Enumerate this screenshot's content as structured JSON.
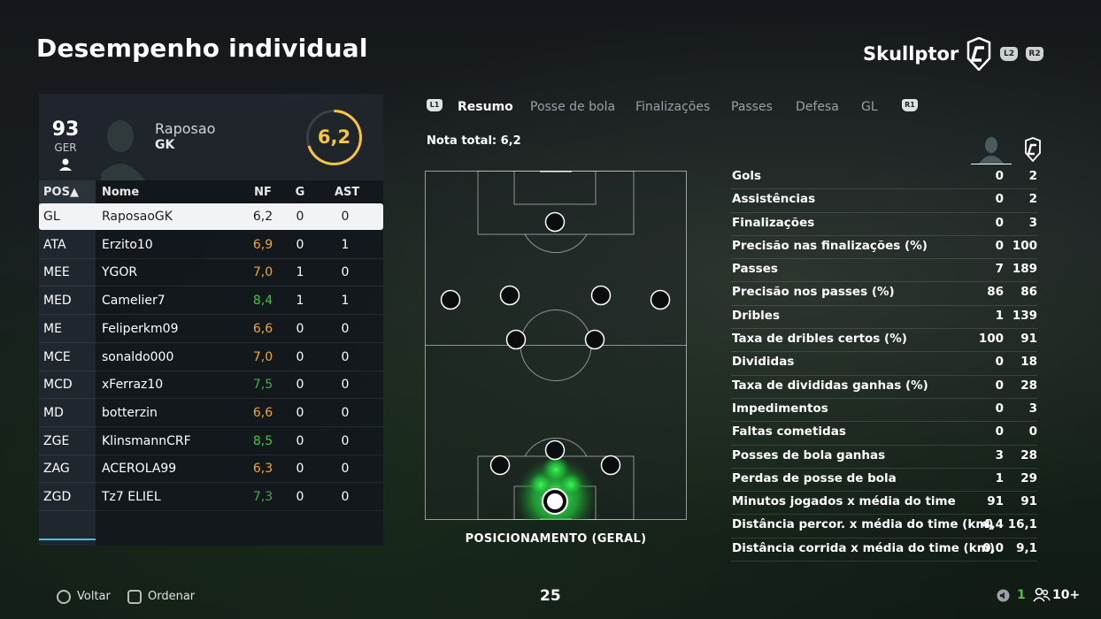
{
  "header": {
    "title": "Desempenho individual",
    "club_name": "Skullptor",
    "l2": "L2",
    "r2": "R2"
  },
  "player_card": {
    "overall": "93",
    "overall_label": "GER",
    "name": "Raposao",
    "position": "GK",
    "rating": "6,2",
    "rating_color": "#f5c542"
  },
  "table": {
    "headers": {
      "pos": "POS▲",
      "name": "Nome",
      "nf": "NF",
      "g": "G",
      "ast": "AST"
    },
    "rows": [
      {
        "pos": "GL",
        "name": "RaposaoGK",
        "nf": "6,2",
        "g": "0",
        "ast": "0",
        "nf_color": "#1a1c1e"
      },
      {
        "pos": "ATA",
        "name": "Erzito10",
        "nf": "6,9",
        "g": "0",
        "ast": "1",
        "nf_color": "#f0a830"
      },
      {
        "pos": "MEE",
        "name": "YGOR",
        "nf": "7,0",
        "g": "1",
        "ast": "0",
        "nf_color": "#f0a830"
      },
      {
        "pos": "MED",
        "name": "Camelier7",
        "nf": "8,4",
        "g": "1",
        "ast": "1",
        "nf_color": "#3ec93e"
      },
      {
        "pos": "ME",
        "name": "Feliperkm09",
        "nf": "6,6",
        "g": "0",
        "ast": "0",
        "nf_color": "#f0a830"
      },
      {
        "pos": "MCE",
        "name": "sonaldo000",
        "nf": "7,0",
        "g": "0",
        "ast": "0",
        "nf_color": "#f0a830"
      },
      {
        "pos": "MCD",
        "name": "xFerraz10",
        "nf": "7,5",
        "g": "0",
        "ast": "0",
        "nf_color": "#4aa84a"
      },
      {
        "pos": "MD",
        "name": "botterzin",
        "nf": "6,6",
        "g": "0",
        "ast": "0",
        "nf_color": "#f0a830"
      },
      {
        "pos": "ZGE",
        "name": "KlinsmannCRF",
        "nf": "8,5",
        "g": "0",
        "ast": "0",
        "nf_color": "#3ec93e"
      },
      {
        "pos": "ZAG",
        "name": "ACEROLA99",
        "nf": "6,3",
        "g": "0",
        "ast": "0",
        "nf_color": "#f0a830"
      },
      {
        "pos": "ZGD",
        "name": "Tz7 ELIEL",
        "nf": "7,3",
        "g": "0",
        "ast": "0",
        "nf_color": "#4aa84a"
      }
    ]
  },
  "tabs": {
    "l1": "L1",
    "r1": "R1",
    "items": [
      "Resumo",
      "Posse de bola",
      "Finalizações",
      "Passes",
      "Defesa",
      "GL"
    ]
  },
  "nota_total": "Nota total: 6,2",
  "pitch": {
    "label": "POSICIONAMENTO (GERAL)"
  },
  "stats": [
    {
      "label": "Gols",
      "a": "0",
      "b": "2"
    },
    {
      "label": "Assistências",
      "a": "0",
      "b": "2"
    },
    {
      "label": "Finalizações",
      "a": "0",
      "b": "3"
    },
    {
      "label": "Precisão nas finalizações (%)",
      "a": "0",
      "b": "100"
    },
    {
      "label": "Passes",
      "a": "7",
      "b": "189"
    },
    {
      "label": "Precisão nos passes (%)",
      "a": "86",
      "b": "86"
    },
    {
      "label": "Dribles",
      "a": "1",
      "b": "139"
    },
    {
      "label": "Taxa de dribles certos (%)",
      "a": "100",
      "b": "91"
    },
    {
      "label": "Divididas",
      "a": "0",
      "b": "18"
    },
    {
      "label": "Taxa de divididas ganhas (%)",
      "a": "0",
      "b": "28"
    },
    {
      "label": "Impedimentos",
      "a": "0",
      "b": "3"
    },
    {
      "label": "Faltas cometidas",
      "a": "0",
      "b": "0"
    },
    {
      "label": "Posses de bola ganhas",
      "a": "3",
      "b": "28"
    },
    {
      "label": "Perdas de posse de bola",
      "a": "1",
      "b": "29"
    },
    {
      "label": "Minutos jogados x média do time",
      "a": "91",
      "b": "91"
    },
    {
      "label": "Distância percor. x média do time (km)",
      "a": "4,4",
      "b": "16,1"
    },
    {
      "label": "Distância corrida x média do time (km)",
      "a": "0,0",
      "b": "9,1"
    }
  ],
  "footer": {
    "back": "Voltar",
    "sort": "Ordenar",
    "page": "25",
    "count": "1",
    "players": "10+"
  }
}
